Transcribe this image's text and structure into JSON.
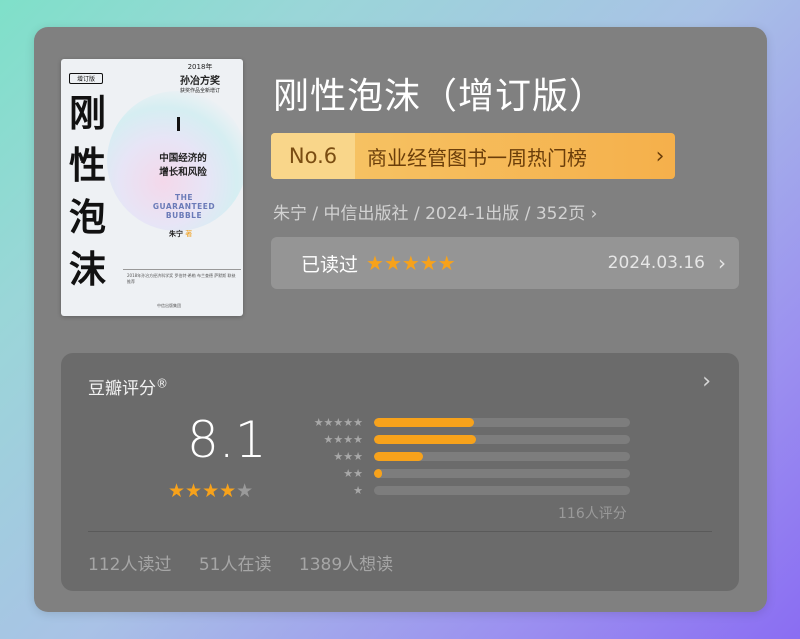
{
  "book": {
    "title": "刚性泡沫（增订版）",
    "meta": "朱宁 / 中信出版社 / 2024-1出版 / 352页 ›",
    "cover": {
      "edition": "增订版",
      "title_chars": [
        "刚",
        "性",
        "泡",
        "沫"
      ],
      "award_year": "2018年",
      "award": "孙冶方奖",
      "award_sub": "获奖作品全新增订",
      "subtitle_line1": "中国经济的",
      "subtitle_line2": "增长和风险",
      "english_line1": "THE",
      "english_line2": "GUARANTEED",
      "english_line3": "BUBBLE",
      "author": "朱宁",
      "author_suffix": "著",
      "blurb": "2018年孙冶方经济科学奖 罗伯特·希勒 布兰查德 萨默斯 联袂推荐",
      "publisher": "中信出版集团"
    }
  },
  "ranking": {
    "number": "No.6",
    "name": "商业经管图书一周热门榜",
    "chevron": "›"
  },
  "read": {
    "label": "已读过",
    "stars": "★★★★★",
    "date": "2024.03.16",
    "chevron": "›"
  },
  "rating": {
    "title": "豆瓣评分",
    "registered": "®",
    "chevron": "›",
    "score": "8.1",
    "stars_filled": "★★★★",
    "stars_empty": "★",
    "count": "116人评分",
    "distribution": [
      {
        "label": "★★★★★",
        "percent": 39
      },
      {
        "label": "★★★★",
        "percent": 40
      },
      {
        "label": "★★★",
        "percent": 19
      },
      {
        "label": "★★",
        "percent": 3
      },
      {
        "label": "★",
        "percent": 0
      }
    ],
    "stats": [
      "112人读过",
      "51人在读",
      "1389人想读"
    ]
  },
  "colors": {
    "accent": "#f7a21b",
    "card": "#808080",
    "panel": "#6b6b6b",
    "rank_bg": "#f5b04b"
  }
}
